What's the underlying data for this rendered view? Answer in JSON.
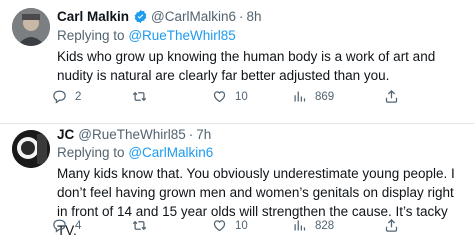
{
  "tweets": [
    {
      "author_name": "Carl Malkin",
      "handle": "@CarlMalkin6",
      "separator": "·",
      "time": "8h",
      "replying_prefix": "Replying to",
      "replying_to": "@RueTheWhirl85",
      "text": "Kids who grow up knowing the human body is a work of art and nudity is natural are clearly far better adjusted than you.",
      "replies": "2",
      "retweets": "",
      "likes": "10",
      "views": "869"
    },
    {
      "author_name": "JC",
      "handle": "@RueTheWhirl85",
      "separator": "·",
      "time": "7h",
      "replying_prefix": "Replying to",
      "replying_to": "@CarlMalkin6",
      "text": "Many kids know that. You obviously underestimate young people. I don’t feel having grown men and women’s genitals on display right in front of 14 and 15 year olds will strengthen the cause. It’s tacky TV.",
      "replies": "4",
      "retweets": "",
      "likes": "10",
      "views": "828"
    }
  ],
  "colors": {
    "text": "#0f1419",
    "secondary": "#536471",
    "link": "#1d9bf0",
    "verified": "#1d9bf0"
  },
  "icons": [
    "verified-badge-icon",
    "reply-icon",
    "retweet-icon",
    "like-icon",
    "views-icon",
    "share-icon"
  ]
}
